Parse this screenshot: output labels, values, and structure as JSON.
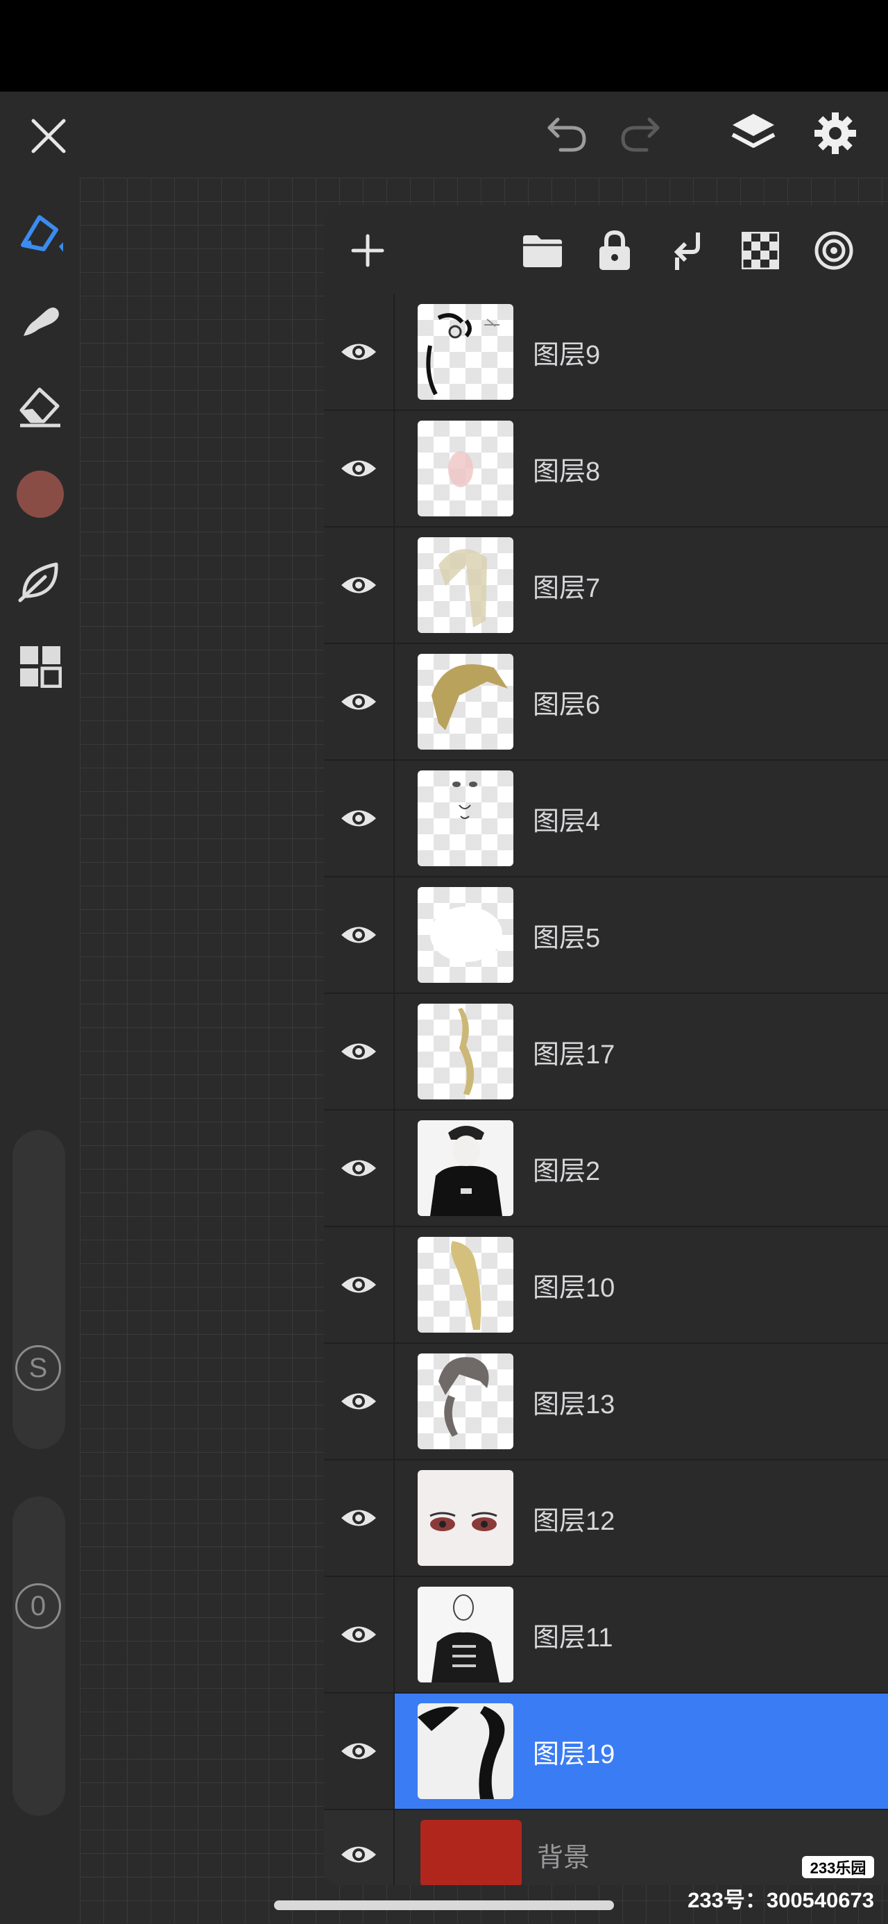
{
  "toolbar": {
    "icons": [
      "close-icon",
      "undo-icon",
      "redo-icon",
      "layers-icon",
      "gear-icon"
    ]
  },
  "sidebar": {
    "tools": [
      "brush-icon",
      "smudge-icon",
      "eraser-icon",
      "color-swatch",
      "leaf-icon",
      "gallery-icon"
    ],
    "color": "#8a4d45",
    "accent": "#3a8cf0",
    "size_knob": "S",
    "opacity_knob": "0"
  },
  "layers_panel": {
    "header_icons": [
      "add-icon",
      "folder-icon",
      "lock-icon",
      "merge-down-icon",
      "checker-icon",
      "target-icon"
    ],
    "layers": [
      {
        "name": "图层9",
        "thumb": "sketch"
      },
      {
        "name": "图层8",
        "thumb": "pink"
      },
      {
        "name": "图层7",
        "thumb": "hair-light"
      },
      {
        "name": "图层6",
        "thumb": "hair-gold"
      },
      {
        "name": "图层4",
        "thumb": "face"
      },
      {
        "name": "图层5",
        "thumb": "white-blob"
      },
      {
        "name": "图层17",
        "thumb": "strand"
      },
      {
        "name": "图层2",
        "thumb": "character"
      },
      {
        "name": "图层10",
        "thumb": "strand-long"
      },
      {
        "name": "图层13",
        "thumb": "hair-grey"
      },
      {
        "name": "图层12",
        "thumb": "eyes"
      },
      {
        "name": "图层11",
        "thumb": "body"
      },
      {
        "name": "图层19",
        "thumb": "dark-shape",
        "selected": true
      },
      {
        "name": "背景",
        "thumb": "background",
        "color": "#b0261c"
      }
    ],
    "selected_color": "#3a7cf3"
  },
  "watermark": {
    "logo": "233乐园",
    "text": "233号：300540673"
  }
}
